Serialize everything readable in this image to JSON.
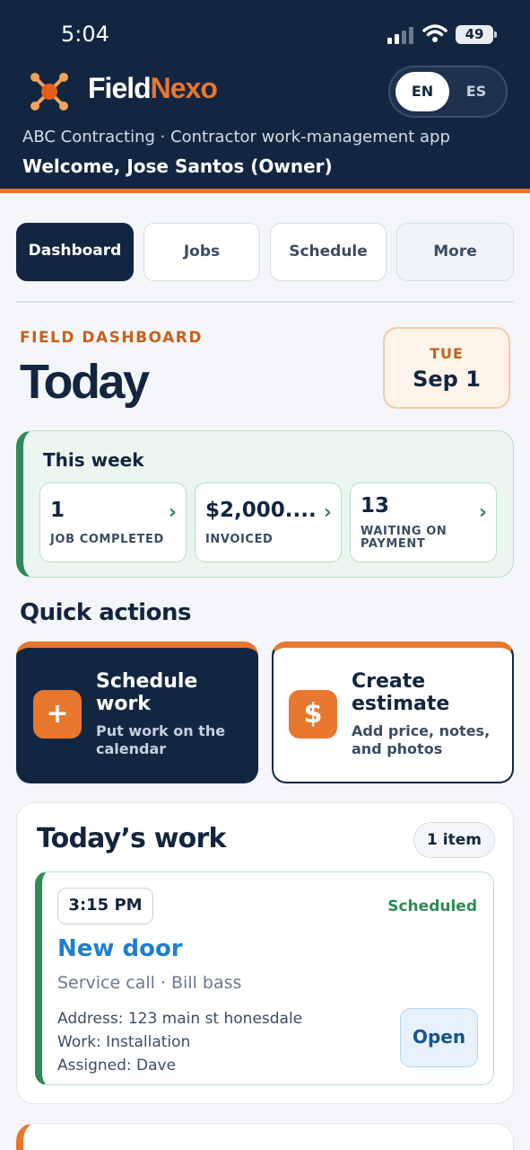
{
  "status_bar": {
    "time": "5:04",
    "battery": "49"
  },
  "header": {
    "brand_part1": "Field",
    "brand_part2": "Nexo",
    "subtitle": "ABC Contracting · Contractor work-management app",
    "welcome": "Welcome, Jose Santos (Owner)",
    "lang_options": [
      "EN",
      "ES"
    ],
    "lang_selected": "EN"
  },
  "nav": {
    "tabs": [
      {
        "label": "Dashboard",
        "active": true
      },
      {
        "label": "Jobs"
      },
      {
        "label": "Schedule"
      },
      {
        "label": "More"
      }
    ]
  },
  "dashboard": {
    "eyebrow": "FIELD DASHBOARD",
    "title": "Today",
    "date_dow": "TUE",
    "date_day": "Sep 1"
  },
  "week": {
    "title": "This week",
    "stats": [
      {
        "value": "1",
        "label": "JOB COMPLETED"
      },
      {
        "value": "$2,000....",
        "label": "INVOICED"
      },
      {
        "value": "13",
        "label_line1": "WAITING ON",
        "label_line2": "PAYMENT"
      }
    ]
  },
  "quick_actions": {
    "title": "Quick actions",
    "items": [
      {
        "icon": "+",
        "icon_name": "plus-icon",
        "title_line1": "Schedule",
        "title_line2": "work",
        "sub_line1": "Put work on the",
        "sub_line2": "calendar"
      },
      {
        "icon": "$",
        "icon_name": "dollar-icon",
        "title_line1": "Create",
        "title_line2": "estimate",
        "sub_line1": "Add price, notes,",
        "sub_line2": "and photos"
      }
    ]
  },
  "todays_work": {
    "title": "Today’s work",
    "count": "1 item",
    "jobs": [
      {
        "time": "3:15 PM",
        "status": "Scheduled",
        "name": "New door",
        "type": "Service call · Bill bass",
        "address": "Address: 123 main st honesdale",
        "work": "Work: Installation",
        "assigned": "Assigned: Dave",
        "open_label": "Open"
      }
    ]
  },
  "colors": {
    "navy": "#132641",
    "orange": "#e8772e",
    "green": "#2f8a55",
    "blue": "#1f7fcf"
  }
}
